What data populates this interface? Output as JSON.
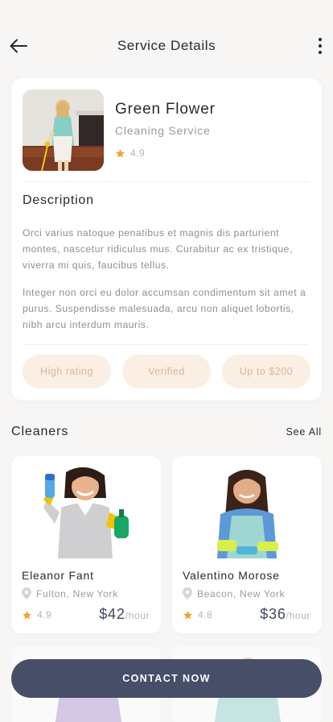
{
  "header": {
    "title": "Service Details"
  },
  "service": {
    "name": "Green Flower",
    "type": "Cleaning Service",
    "rating": "4.9"
  },
  "description": {
    "title": "Description",
    "paragraphs": [
      "Orci varius natoque penatibus et magnis dis parturient montes, nascetur ridiculus mus. Curabitur ac ex tristique, viverra mi quis, faucibus tellus.",
      "Integer non orci eu dolor accumsan condimentum sit amet a purus. Suspendisse malesuada, arcu non aliquet lobortis, nibh arcu interdum mauris."
    ]
  },
  "tags": [
    "High rating",
    "Verified",
    "Up to $200"
  ],
  "cleaners_section": {
    "title": "Cleaners",
    "see_all": "See All"
  },
  "cleaners": [
    {
      "name": "Eleanor Fant",
      "location": "Fulton, New York",
      "rating": "4.9",
      "price": "$42",
      "unit": "/hour"
    },
    {
      "name": "Valentino Morose",
      "location": "Beacon, New York",
      "rating": "4.8",
      "price": "$36",
      "unit": "/hour"
    }
  ],
  "cta": {
    "label": "CONTACT NOW"
  },
  "colors": {
    "accent": "#474e68",
    "star": "#f4a12c",
    "tag_bg": "#fbeee2",
    "tag_text": "#d7b79a"
  }
}
